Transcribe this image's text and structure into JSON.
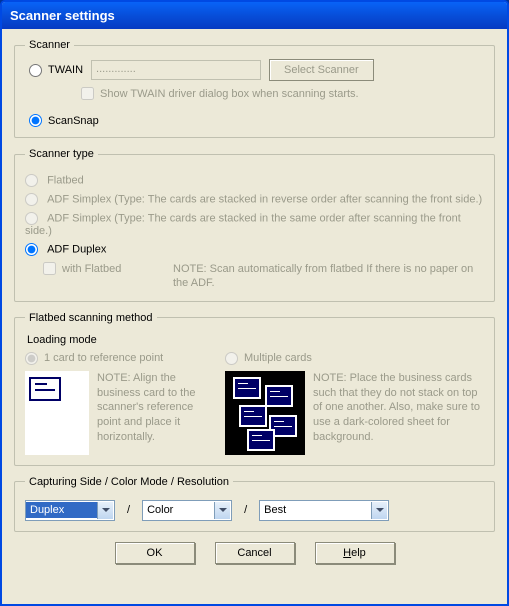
{
  "title": "Scanner settings",
  "scanner": {
    "legend": "Scanner",
    "twain_label": "TWAIN",
    "twain_value": ".............",
    "select_scanner_btn": "Select Scanner",
    "show_twain_dialog": "Show TWAIN driver dialog box when scanning starts.",
    "scansnap_label": "ScanSnap"
  },
  "scanner_type": {
    "legend": "Scanner type",
    "flatbed": "Flatbed",
    "adf_simplex_rev": "ADF Simplex (Type: The cards are stacked in reverse order after scanning the front side.)",
    "adf_simplex_same": "ADF Simplex (Type: The cards are stacked in the same order after scanning the front side.)",
    "adf_duplex": "ADF Duplex",
    "with_flatbed": "with Flatbed",
    "note": "NOTE: Scan automatically from flatbed If there is no paper on the ADF."
  },
  "flatbed_method": {
    "legend": "Flatbed scanning method",
    "loading_mode": "Loading mode",
    "one_card": "1 card to reference point",
    "multiple": "Multiple cards",
    "note_left": "NOTE: Align the business card to the scanner's reference point and place it horizontally.",
    "note_right": "NOTE: Place the business cards such that they do not stack on top of one another. Also, make sure to use a dark-colored sheet for background."
  },
  "capture": {
    "legend": "Capturing Side / Color Mode / Resolution",
    "side": "Duplex",
    "color": "Color",
    "res": "Best",
    "slash": "/"
  },
  "buttons": {
    "ok": "OK",
    "cancel": "Cancel",
    "help": "Help"
  }
}
